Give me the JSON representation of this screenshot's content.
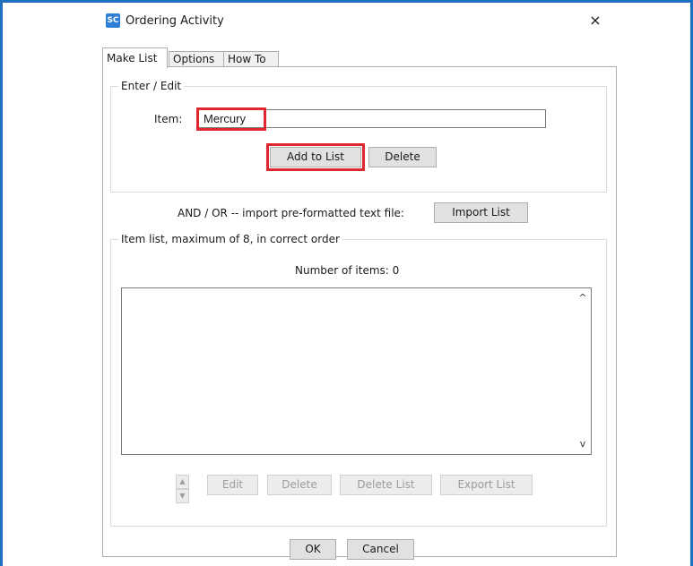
{
  "window": {
    "title": "Ordering Activity",
    "app_icon_text": "SC",
    "close_glyph": "×"
  },
  "tabs": [
    {
      "label": "Make List",
      "active": true
    },
    {
      "label": "Options",
      "active": false
    },
    {
      "label": "How To",
      "active": false
    }
  ],
  "enter_edit": {
    "legend": "Enter / Edit",
    "item_label": "Item:",
    "item_value": "Mercury",
    "add_button": "Add to List",
    "delete_button": "Delete"
  },
  "import": {
    "label": "AND / OR -- import pre-formatted text file:",
    "button": "Import List"
  },
  "item_list": {
    "legend": "Item list, maximum of 8, in correct order",
    "count_text": "Number of items: 0",
    "items": [],
    "scroll_up_glyph": "^",
    "scroll_down_glyph": "v",
    "move_up_glyph": "▲",
    "move_down_glyph": "▼",
    "buttons": {
      "edit": "Edit",
      "delete": "Delete",
      "delete_list": "Delete List",
      "export_list": "Export List"
    }
  },
  "footer": {
    "ok": "OK",
    "cancel": "Cancel"
  },
  "colors": {
    "frame": "#1f6fc0",
    "highlight": "#e0262f",
    "button_face": "#e1e1e1"
  }
}
